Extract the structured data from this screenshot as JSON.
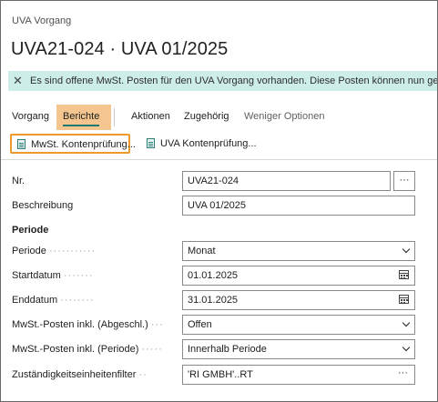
{
  "header": {
    "entity_type": "UVA Vorgang",
    "title": "UVA21-024 · UVA 01/2025"
  },
  "banner": {
    "close_glyph": "✕",
    "message": "Es sind offene MwSt. Posten für den UVA Vorgang vorhanden. Diese Posten können nun gebucht werden."
  },
  "actionbar": {
    "vorgang": "Vorgang",
    "berichte": "Berichte",
    "aktionen": "Aktionen",
    "zugehoerig": "Zugehörig",
    "weniger": "Weniger Optionen"
  },
  "reports": {
    "mwst": "MwSt. Kontenprüfung...",
    "uva": "UVA Kontenprüfung..."
  },
  "form": {
    "nr": {
      "label": "Nr.",
      "value": "UVA21-024",
      "assist": "···"
    },
    "beschreibung": {
      "label": "Beschreibung",
      "value": "UVA 01/2025"
    },
    "group_periode": "Periode",
    "periode": {
      "label": "Periode",
      "value": "Monat"
    },
    "startdatum": {
      "label": "Startdatum",
      "value": "01.01.2025"
    },
    "enddatum": {
      "label": "Enddatum",
      "value": "31.01.2025"
    },
    "mwst_abgeschl": {
      "label": "MwSt.-Posten inkl. (Abgeschl.)",
      "value": "Offen"
    },
    "mwst_periode": {
      "label": "MwSt.-Posten inkl. (Periode)",
      "value": "Innerhalb Periode"
    },
    "filter": {
      "label": "Zuständigkeitseinheitenfilter",
      "value": "'RI GMBH'..RT",
      "assist": "···"
    }
  },
  "colors": {
    "banner_bg": "#cdeee8",
    "berichte_highlight": "#f4c58f",
    "accent": "#1a7a72",
    "report_highlight_border": "#ec9a2c"
  },
  "icons": {
    "banner_close": "close-icon",
    "report": "report-icon",
    "dropdown": "chevron-down-icon",
    "calendar": "calendar-icon"
  }
}
